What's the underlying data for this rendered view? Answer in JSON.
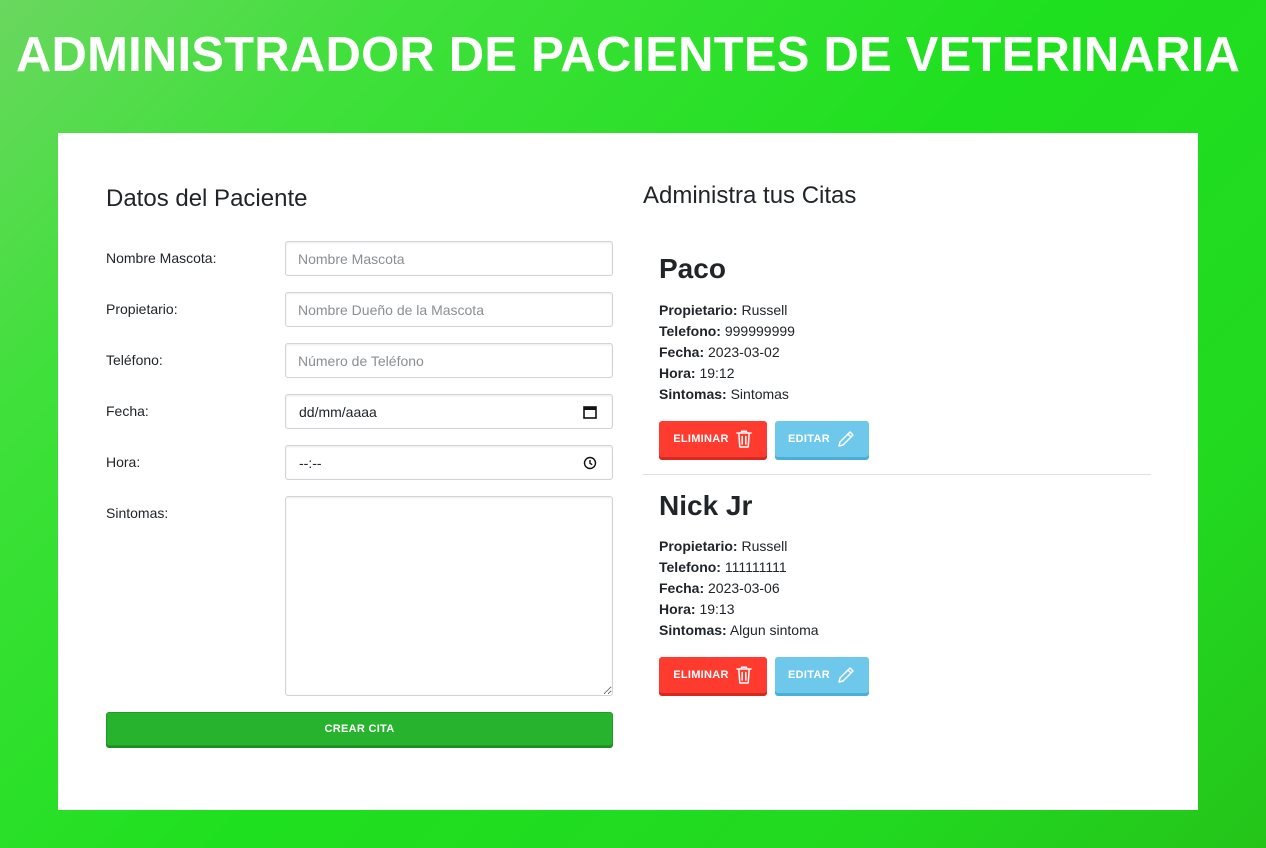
{
  "header": {
    "title": "ADMINISTRADOR DE PACIENTES DE VETERINARIA"
  },
  "form": {
    "title": "Datos del Paciente",
    "fields": {
      "pet_name": {
        "label": "Nombre Mascota:",
        "placeholder": "Nombre Mascota",
        "value": ""
      },
      "owner": {
        "label": "Propietario:",
        "placeholder": "Nombre Dueño de la Mascota",
        "value": ""
      },
      "phone": {
        "label": "Teléfono:",
        "placeholder": "Número de Teléfono",
        "value": ""
      },
      "date": {
        "label": "Fecha:",
        "display": "dd/mm/aaaa"
      },
      "time": {
        "label": "Hora:",
        "display": "--:--"
      },
      "symptoms": {
        "label": "Sintomas:",
        "value": ""
      }
    },
    "submit_label": "CREAR CITA"
  },
  "appointments": {
    "title": "Administra tus Citas",
    "field_labels": {
      "owner": "Propietario:",
      "phone": "Telefono:",
      "date": "Fecha:",
      "time": "Hora:",
      "symptoms": "Sintomas:"
    },
    "delete_label": "ELIMINAR",
    "edit_label": "EDITAR",
    "items": [
      {
        "pet": "Paco",
        "owner": "Russell",
        "phone": "999999999",
        "date": "2023-03-02",
        "time": "19:12",
        "symptoms": "Sintomas"
      },
      {
        "pet": "Nick Jr",
        "owner": "Russell",
        "phone": "111111111",
        "date": "2023-03-06",
        "time": "19:13",
        "symptoms": "Algun sintoma"
      }
    ]
  },
  "colors": {
    "background_gradient_start": "#6ad75f",
    "background_gradient_end": "#25c41a",
    "submit_button": "#28b32f",
    "delete_button": "#ff3b30",
    "edit_button": "#6ec8ec"
  },
  "icons": {
    "delete": "trash-icon",
    "edit": "pencil-icon",
    "date": "calendar-icon",
    "time": "clock-icon"
  }
}
